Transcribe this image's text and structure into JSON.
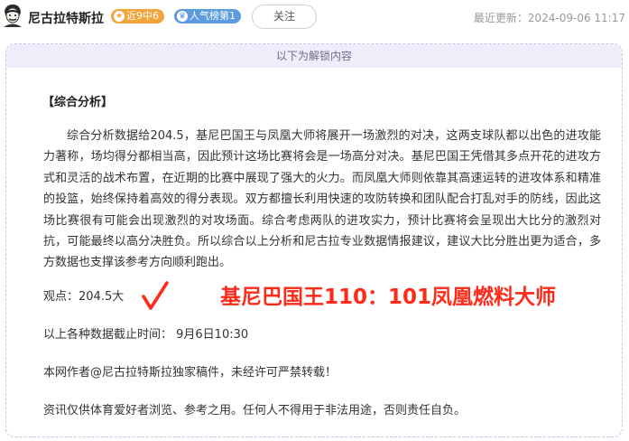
{
  "header": {
    "author_name": "尼古拉特斯拉",
    "badge_streak": "近9中6",
    "badge_popularity": "人气榜第1",
    "follow_label": "关注",
    "update_time": "最近更新：2024-09-06 11:17"
  },
  "card": {
    "unlock_banner": "以下为解锁内容",
    "section_title": "【综合分析】",
    "analysis": "综合分析数据给204.5，基尼巴国王与凤凰大师将展开一场激烈的对决，这两支球队都以出色的进攻能力著称，场均得分都相当高，因此预计这场比赛将会是一场高分对决。基尼巴国王凭借其多点开花的进攻方式和灵活的战术布置，在近期的比赛中展现了强大的火力。而凤凰大师则依靠其高速运转的进攻体系和精准的投篮，始终保持着高效的得分表现。双方都擅长利用快速的攻防转换和团队配合打乱对手的防线，因此这场比赛很有可能会出现激烈的对攻场面。综合考虑两队的进攻实力，预计比赛将会呈现出大比分的激烈对抗，可能最终以高分决胜负。所以综合以上分析和尼古拉专业数据情报建议，建议大比分胜出更为适合，多方数据也支撑该参考方向顺利跑出。",
    "viewpoint": "观点：204.5大",
    "result_overlay": "基尼巴国王110：101凤凰燃料大师",
    "cutoff_time": "以上各种数据截止时间：  9月6日10:30",
    "author_note": "本网作者@尼古拉特斯拉独家稿件，未经许可严禁转载！",
    "disclaimer": "资讯仅供体育爱好者浏览、参考之用。任何人不得用于非法用途，否则责任自负。"
  },
  "icons": {
    "avatar": "avatar-portrait",
    "streak_badge_icon": "star-icon",
    "popularity_badge_icon": "trophy-icon",
    "checkmark": "checkmark-icon"
  },
  "colors": {
    "result_red": "#ff2a1a",
    "streak_orange": "#f2a33a",
    "popularity_blue": "#5b9bde",
    "banner_bg": "#efedf9"
  }
}
